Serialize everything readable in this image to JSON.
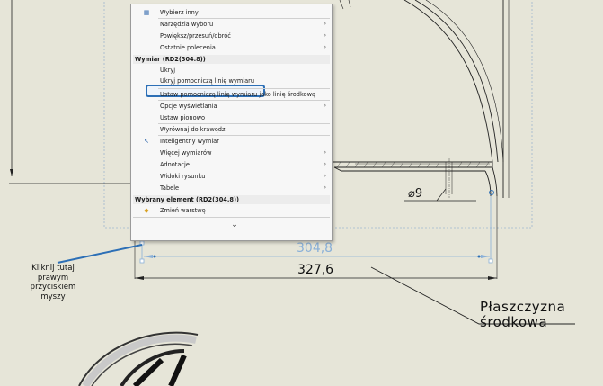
{
  "menu": {
    "items_top": [
      {
        "label": "Wybierz inny",
        "arrow": false,
        "icon": "select-other-icon"
      },
      {
        "label": "Narzędzia wyboru",
        "arrow": true
      },
      {
        "label": "Powiększ/przesuń/obróć",
        "arrow": true
      },
      {
        "label": "Ostatnie polecenia",
        "arrow": true
      }
    ],
    "section1_header": "Wymiar (RD2(304.8))",
    "section1_items": [
      {
        "label": "Ukryj",
        "arrow": false
      },
      {
        "label": "Ukryj pomocniczą linię wymiaru",
        "arrow": false,
        "highlighted": true
      },
      {
        "label": "Ustaw pomocniczą linię wymiaru jako linię środkową",
        "arrow": false
      },
      {
        "label": "Opcje wyświetlania",
        "arrow": true
      },
      {
        "label": "Ustaw pionowo",
        "arrow": false
      },
      {
        "label": "Wyrównaj do krawędzi",
        "arrow": false
      },
      {
        "label": "Inteligentny wymiar",
        "arrow": false,
        "icon": "smart-dimension-icon"
      },
      {
        "label": "Więcej wymiarów",
        "arrow": true
      },
      {
        "label": "Adnotacje",
        "arrow": true
      },
      {
        "label": "Widoki rysunku",
        "arrow": true
      },
      {
        "label": "Tabele",
        "arrow": true
      }
    ],
    "section2_header": "Wybrany element (RD2(304.8))",
    "section2_items": [
      {
        "label": "Zmień warstwę",
        "arrow": false,
        "icon": "layer-icon"
      }
    ],
    "expand_glyph": "⌄"
  },
  "drawing": {
    "dim_inner": "304,8",
    "dim_outer": "327,6",
    "dim_hole": "⌀9",
    "plane_label_line1": "Płaszczyzna",
    "plane_label_line2": "środkowa"
  },
  "callout": {
    "line1": "Kliknij tutaj",
    "line2": "prawym",
    "line3": "przyciskiem",
    "line4": "myszy"
  },
  "colors": {
    "background": "#e6e5d8",
    "highlight_border": "#2c6fb6",
    "callout_line": "#2c6fb6",
    "dim_selected": "#8ab0d8"
  }
}
